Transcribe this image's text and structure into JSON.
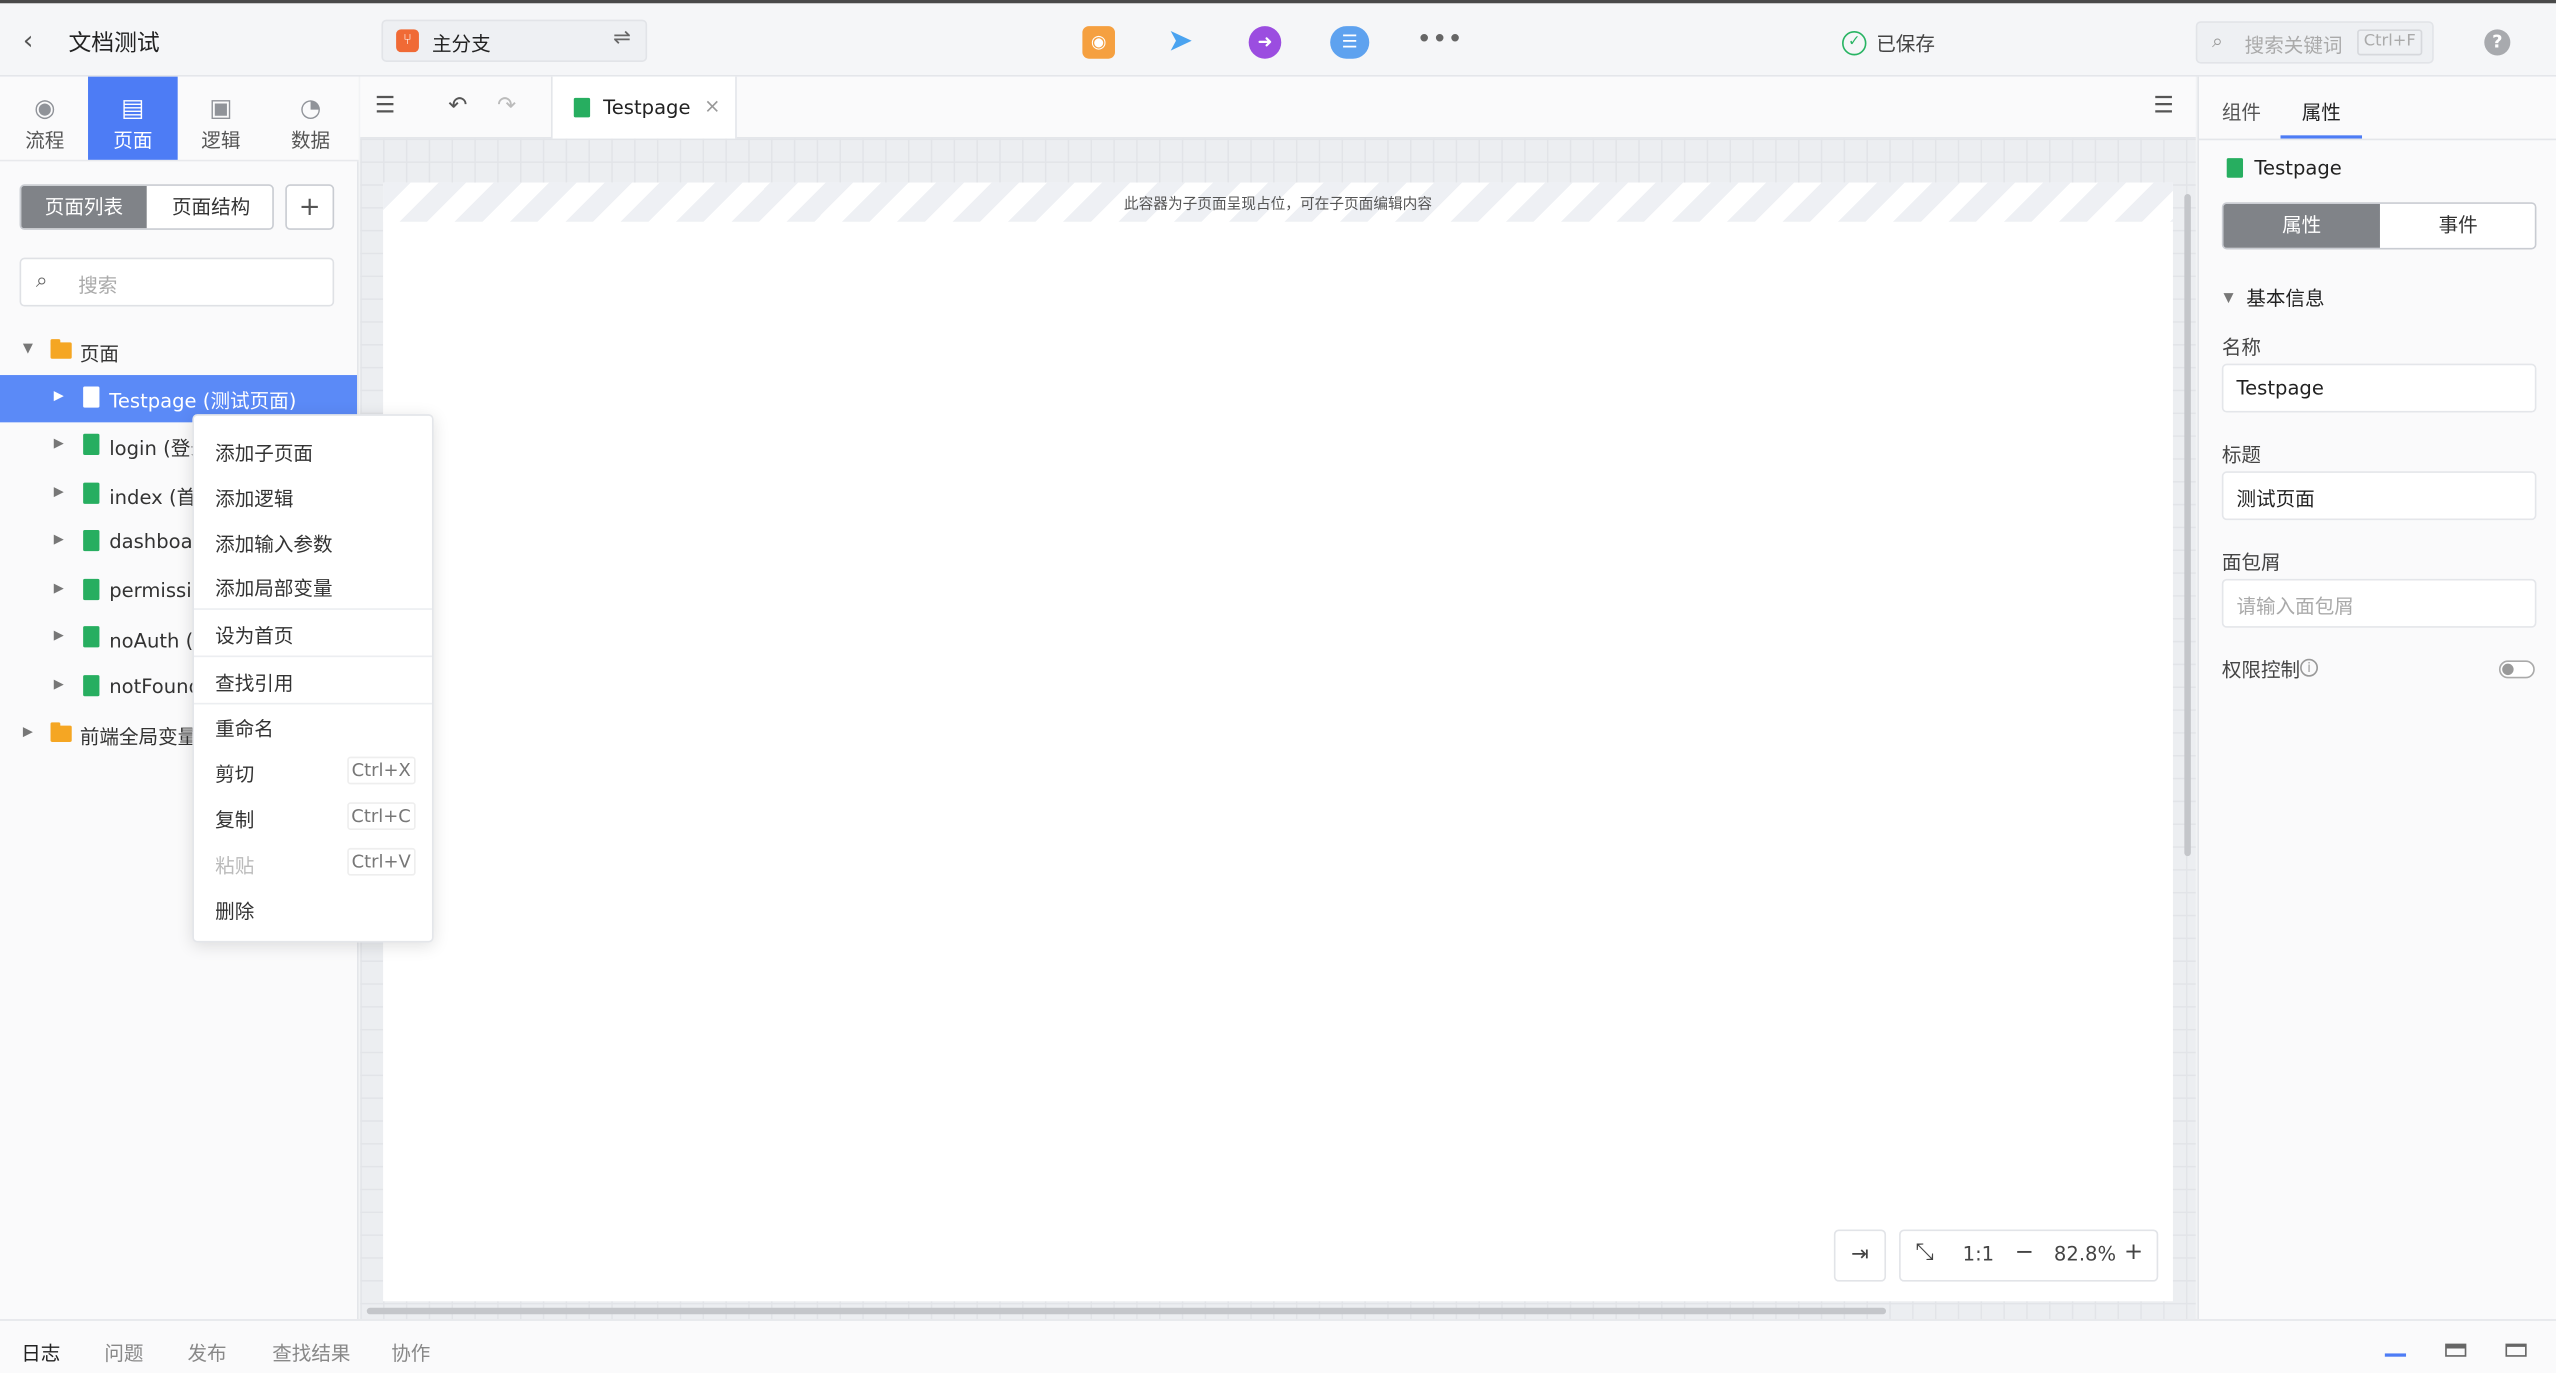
{
  "header": {
    "back_icon": "chevron-left-icon",
    "title": "文档测试",
    "branch": {
      "label": "主分支",
      "icon": "branch-icon",
      "swap_icon": "swap-icon"
    },
    "toolbar_icons": [
      "preview-icon",
      "publish-plane-icon",
      "export-icon",
      "cloud-icon",
      "more-icon"
    ],
    "saved_text": "已保存",
    "search": {
      "placeholder": "搜索关键词",
      "shortcut": "Ctrl+F"
    },
    "help": "?"
  },
  "left_nav": {
    "items": [
      {
        "label": "流程",
        "icon": "process-icon",
        "active": false
      },
      {
        "label": "页面",
        "icon": "page-icon",
        "active": true
      },
      {
        "label": "逻辑",
        "icon": "chip-icon",
        "active": false
      },
      {
        "label": "数据",
        "icon": "pie-icon",
        "active": false
      }
    ]
  },
  "left_panel": {
    "segments": [
      "页面列表",
      "页面结构"
    ],
    "add": "+",
    "search_placeholder": "搜索",
    "tree": [
      {
        "label": "页面",
        "type": "folder",
        "expanded": true
      },
      {
        "label": "Testpage (测试页面)",
        "type": "page",
        "selected": true
      },
      {
        "label": "login (登录",
        "type": "page"
      },
      {
        "label": "index (首页",
        "type": "page"
      },
      {
        "label": "dashboard",
        "type": "page"
      },
      {
        "label": "permission",
        "type": "page"
      },
      {
        "label": "noAuth (无",
        "type": "page"
      },
      {
        "label": "notFound",
        "type": "page"
      },
      {
        "label": "前端全局变量",
        "type": "folder",
        "expanded": false
      }
    ]
  },
  "context_menu": {
    "items": [
      {
        "label": "添加子页面"
      },
      {
        "label": "添加逻辑"
      },
      {
        "label": "添加输入参数"
      },
      {
        "label": "添加局部变量"
      },
      {
        "label": "设为首页"
      },
      {
        "label": "查找引用"
      },
      {
        "label": "重命名"
      },
      {
        "label": "剪切",
        "shortcut": "Ctrl+X"
      },
      {
        "label": "复制",
        "shortcut": "Ctrl+C"
      },
      {
        "label": "粘贴",
        "shortcut": "Ctrl+V",
        "disabled": true
      },
      {
        "label": "删除"
      }
    ]
  },
  "editor": {
    "tab_label": "Testpage",
    "tab_close": "×",
    "placeholder_text": "此容器为子页面呈现占位，可在子页面编辑内容",
    "zoom": {
      "ratio_label": "1:1",
      "minus": "−",
      "value": "82.8%",
      "plus": "+"
    }
  },
  "right_panel": {
    "tabs": [
      "组件",
      "属性"
    ],
    "active_tab": "属性",
    "page_name": "Testpage",
    "segments": [
      "属性",
      "事件"
    ],
    "section": "基本信息",
    "fields": {
      "name_label": "名称",
      "name_value": "Testpage",
      "title_label": "标题",
      "title_value": "测试页面",
      "breadcrumb_label": "面包屑",
      "breadcrumb_placeholder": "请输入面包屑",
      "permission_label": "权限控制",
      "permission_info": "i"
    }
  },
  "bottom_bar": {
    "tabs": [
      "日志",
      "问题",
      "发布",
      "查找结果",
      "协作"
    ],
    "active": "日志"
  },
  "colors": {
    "accent": "#4d7cf5",
    "page_green": "#27ae60",
    "folder_orange": "#f5a623",
    "saved_green": "#28b463"
  }
}
